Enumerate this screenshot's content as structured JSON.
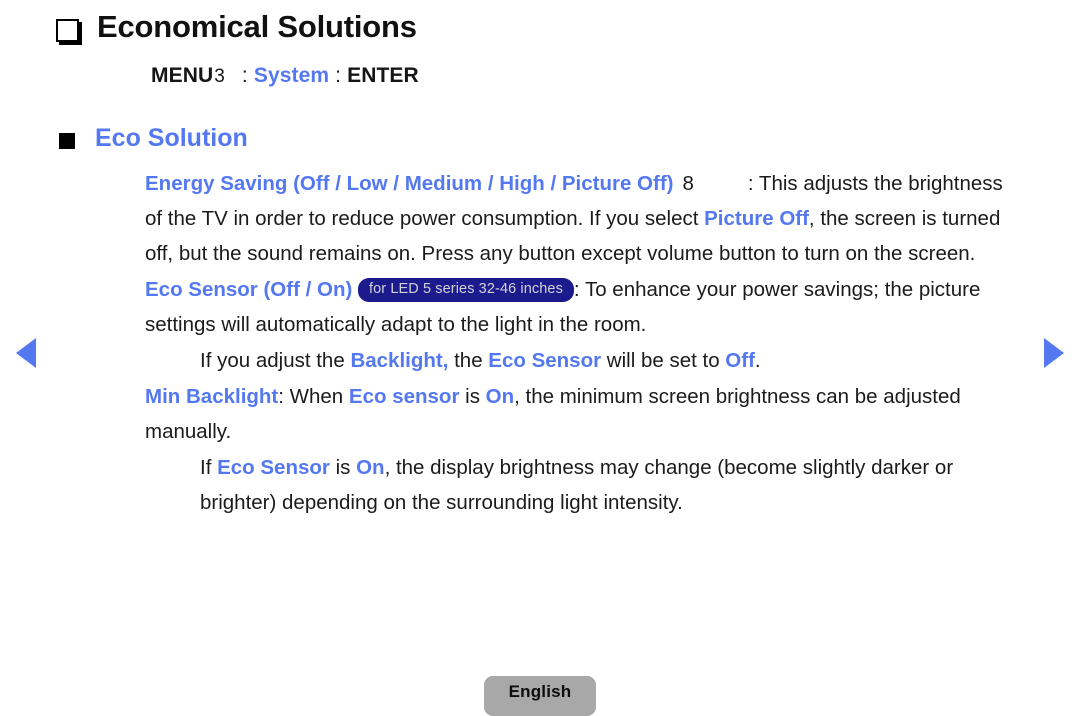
{
  "header": {
    "bullet_icon": "hollow-square-icon",
    "title": "Economical Solutions"
  },
  "menu_path": {
    "menu_label": "MENU",
    "menu_glyph": "3",
    "separator": ":",
    "target": "System",
    "enter_label": "ENTER"
  },
  "section": {
    "bullet_icon": "filled-square-icon",
    "title": "Eco Solution"
  },
  "content": {
    "energy_saving": {
      "term": "Energy Saving (Off / Low / Medium / High / Picture Off)",
      "glyph": "8",
      "separator": ":",
      "text_1": "This adjusts the brightness of the TV in order to reduce power consumption. If you select ",
      "highlight_1": "Picture Off",
      "text_2": ", the screen is turned off, but the sound remains on. Press any button except volume button to turn on the screen."
    },
    "eco_sensor": {
      "term": "Eco Sensor (Off / On)",
      "badge": "for LED 5 series 32-46 inches",
      "separator": ":",
      "text_1": "To enhance your power savings; the picture settings will automatically adapt to the light in the room."
    },
    "backlight_note": {
      "text_1": "If you adjust the ",
      "highlight_1": "Backlight,",
      "text_2": " the ",
      "highlight_2": "Eco Sensor",
      "text_3": " will be set to ",
      "highlight_3": "Off",
      "text_4": "."
    },
    "min_backlight": {
      "term": "Min Backlight",
      "text_1": ": When ",
      "highlight_1": "Eco sensor",
      "text_2": " is ",
      "highlight_2": "On",
      "text_3": ", the minimum screen brightness can be adjusted manually."
    },
    "eco_sensor_note": {
      "text_1": "If ",
      "highlight_1": "Eco Sensor",
      "text_2": " is ",
      "highlight_2": "On",
      "text_3": ", the display brightness may change (become slightly darker or brighter) depending on the surrounding light intensity."
    }
  },
  "nav": {
    "prev_icon": "triangle-left-icon",
    "next_icon": "triangle-right-icon"
  },
  "footer": {
    "language": "English"
  },
  "colors": {
    "accent_blue": "#5478f0",
    "badge_navy": "#1b1b8e",
    "badge_text": "#d2d2d8",
    "footer_gray": "#a8a8a8",
    "body_text": "#1b1b1b"
  }
}
